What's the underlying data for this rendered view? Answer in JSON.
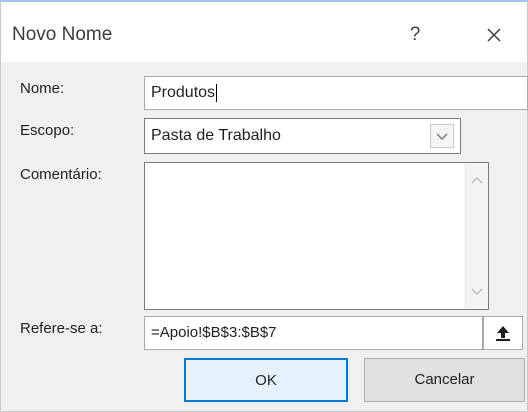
{
  "dialog": {
    "title": "Novo Nome",
    "help_glyph": "?"
  },
  "fields": {
    "name_label": "Nome:",
    "name_value": "Produtos",
    "scope_label": "Escopo:",
    "scope_value": "Pasta de Trabalho",
    "comment_label": "Comentário:",
    "comment_value": "",
    "refers_label": "Refere-se a:",
    "refers_value": "=Apoio!$B$3:$B$7"
  },
  "buttons": {
    "ok": "OK",
    "cancel": "Cancelar"
  },
  "colors": {
    "accent": "#0078d7",
    "window_bg": "#f0f0f0",
    "titlebar_bg": "#ffffff"
  },
  "icons": [
    "help-icon",
    "close-icon",
    "dropdown-chevron-icon",
    "scroll-up-icon",
    "scroll-down-icon",
    "collapse-dialog-icon"
  ]
}
